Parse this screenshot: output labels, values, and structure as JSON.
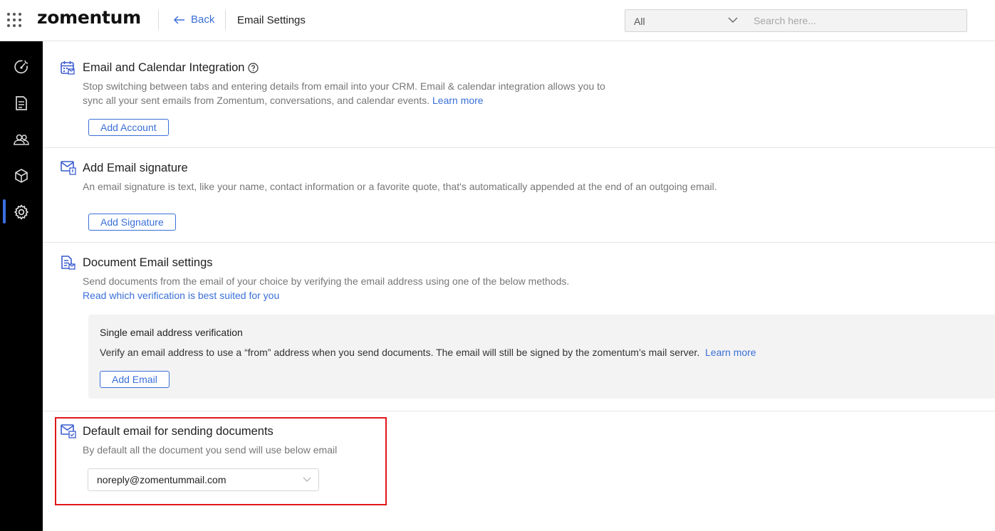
{
  "app": {
    "logo_text": "zomentum",
    "back_label": "Back",
    "page_title": "Email Settings",
    "accent_color": "#3a6fd8",
    "highlight_color": "#e0161b"
  },
  "search": {
    "scope_value": "All",
    "placeholder": "Search here..."
  },
  "sidebar": {
    "items": [
      {
        "icon": "dashboard-icon",
        "active": false
      },
      {
        "icon": "document-icon",
        "active": false
      },
      {
        "icon": "users-icon",
        "active": false
      },
      {
        "icon": "box-icon",
        "active": false
      },
      {
        "icon": "gear-icon",
        "active": true
      }
    ]
  },
  "integration": {
    "title": "Email and Calendar Integration",
    "desc_line1": "Stop switching between tabs and entering details from email into your CRM. Email & calendar integration allows you to",
    "desc_line2": "sync all your sent emails from Zomentum, conversations, and calendar events.",
    "learn_more": "Learn more",
    "button": "Add Account"
  },
  "signature": {
    "title": "Add Email signature",
    "desc": "An email signature is text, like your name, contact information or a favorite quote, that's automatically appended at the end of an outgoing email.",
    "button": "Add Signature"
  },
  "document_email": {
    "title": "Document Email settings",
    "desc": "Send documents from the email of your choice by verifying the email address using one of the below methods.",
    "read_link": "Read which verification is best suited for you",
    "verification": {
      "title": "Single email address verification",
      "desc": "Verify an email address to use a “from” address when you send documents. The email will still be signed by the zomentum’s mail server.",
      "learn_more": "Learn more",
      "button": "Add Email"
    }
  },
  "default_email": {
    "title": "Default email for sending documents",
    "desc": "By default all the document you send will use below email",
    "selected": "noreply@zomentummail.com"
  }
}
